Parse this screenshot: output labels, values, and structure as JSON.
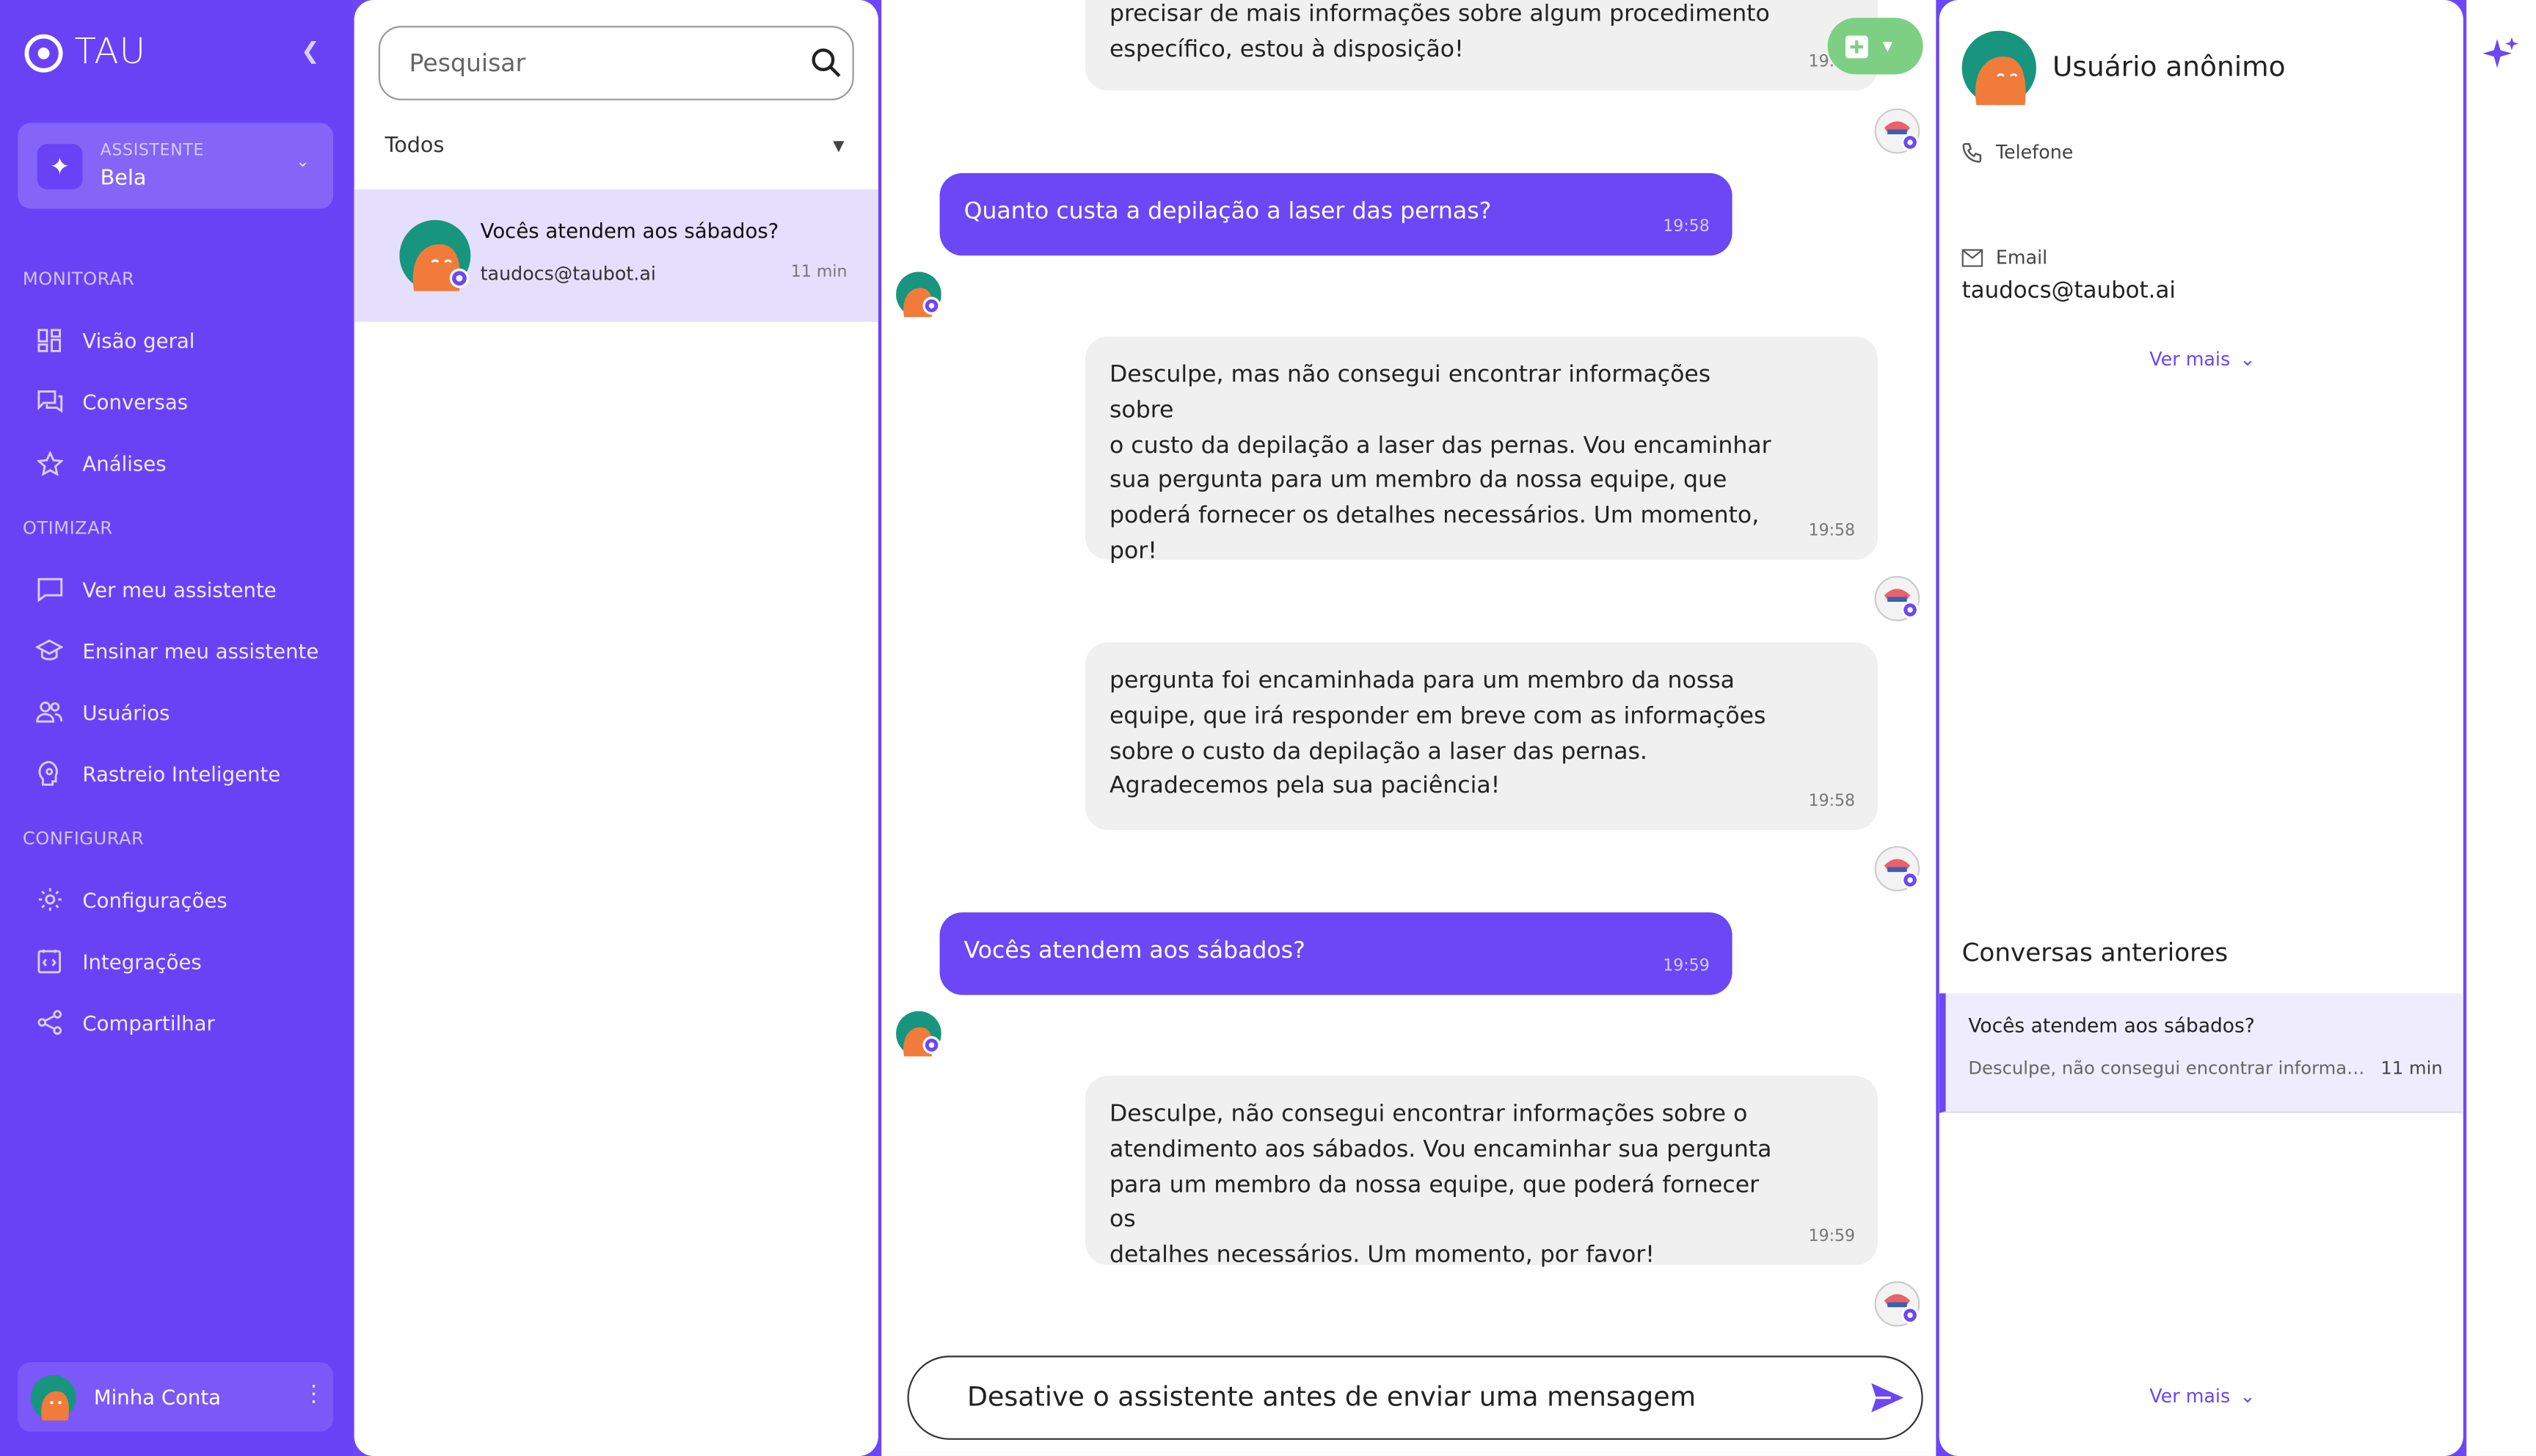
{
  "brand": {
    "name": "TAU"
  },
  "assistant": {
    "caption": "ASSISTENTE",
    "name": "Bela"
  },
  "sidebar": {
    "sections": [
      {
        "title": "MONITORAR",
        "items": [
          {
            "label": "Visão geral",
            "icon": "dashboard-icon"
          },
          {
            "label": "Conversas",
            "icon": "chat-icon"
          },
          {
            "label": "Análises",
            "icon": "star-icon"
          }
        ]
      },
      {
        "title": "OTIMIZAR",
        "items": [
          {
            "label": "Ver meu assistente",
            "icon": "message-icon"
          },
          {
            "label": "Ensinar meu assistente",
            "icon": "school-icon"
          },
          {
            "label": "Usuários",
            "icon": "users-icon"
          },
          {
            "label": "Rastreio Inteligente",
            "icon": "brain-icon"
          }
        ]
      },
      {
        "title": "CONFIGURAR",
        "items": [
          {
            "label": "Configurações",
            "icon": "gear-icon"
          },
          {
            "label": "Integrações",
            "icon": "integration-icon"
          },
          {
            "label": "Compartilhar",
            "icon": "share-icon"
          }
        ]
      }
    ],
    "account_label": "Minha Conta"
  },
  "conversation_list": {
    "search_placeholder": "Pesquisar",
    "filter": "Todos",
    "items": [
      {
        "title": "Vocês atendem aos sábados?",
        "email": "taudocs@taubot.ai",
        "time": "11 min"
      }
    ]
  },
  "chat": {
    "messages": [
      {
        "from": "bot",
        "text": "precisar de mais informações sobre algum procedimento\nespecífico, estou à disposição!",
        "time": "19:58"
      },
      {
        "from": "user",
        "text": "Quanto custa a depilação a laser das pernas?",
        "time": "19:58"
      },
      {
        "from": "bot",
        "text": "Desculpe, mas não consegui encontrar informações sobre\no custo da depilação a laser das pernas. Vou encaminhar\nsua pergunta para um membro da nossa equipe, que\npoderá fornecer os detalhes necessários. Um momento,\npor!",
        "time": "19:58"
      },
      {
        "from": "bot",
        "text": "pergunta foi encaminhada para um membro da nossa\nequipe, que irá responder em breve com as informações\nsobre o custo da depilação a laser das pernas.\nAgradecemos pela sua paciência!",
        "time": "19:58"
      },
      {
        "from": "user",
        "text": "Vocês atendem aos sábados?",
        "time": "19:59"
      },
      {
        "from": "bot",
        "text": "Desculpe, não consegui encontrar informações sobre o\natendimento aos sábados. Vou encaminhar sua pergunta\npara um membro da nossa equipe, que poderá fornecer os\ndetalhes necessários. Um momento, por favor!",
        "time": "19:59"
      }
    ],
    "composer_placeholder": "Desative o assistente antes de enviar uma mensagem"
  },
  "user_panel": {
    "name": "Usuário anônimo",
    "phone_label": "Telefone",
    "email_label": "Email",
    "email_value": "taudocs@taubot.ai",
    "see_more": "Ver mais",
    "previous_title": "Conversas anteriores",
    "previous": [
      {
        "title": "Vocês atendem aos sábados?",
        "preview": "Desculpe, não consegui encontrar informações sobre o atendimento aos sábados.",
        "time": "11 min"
      }
    ],
    "see_more_bottom": "Ver mais"
  },
  "colors": {
    "accent": "#6b47f5",
    "sidebar": "#6a42f6",
    "action_green": "#7ccf83",
    "selected_row": "#e5dffd"
  }
}
